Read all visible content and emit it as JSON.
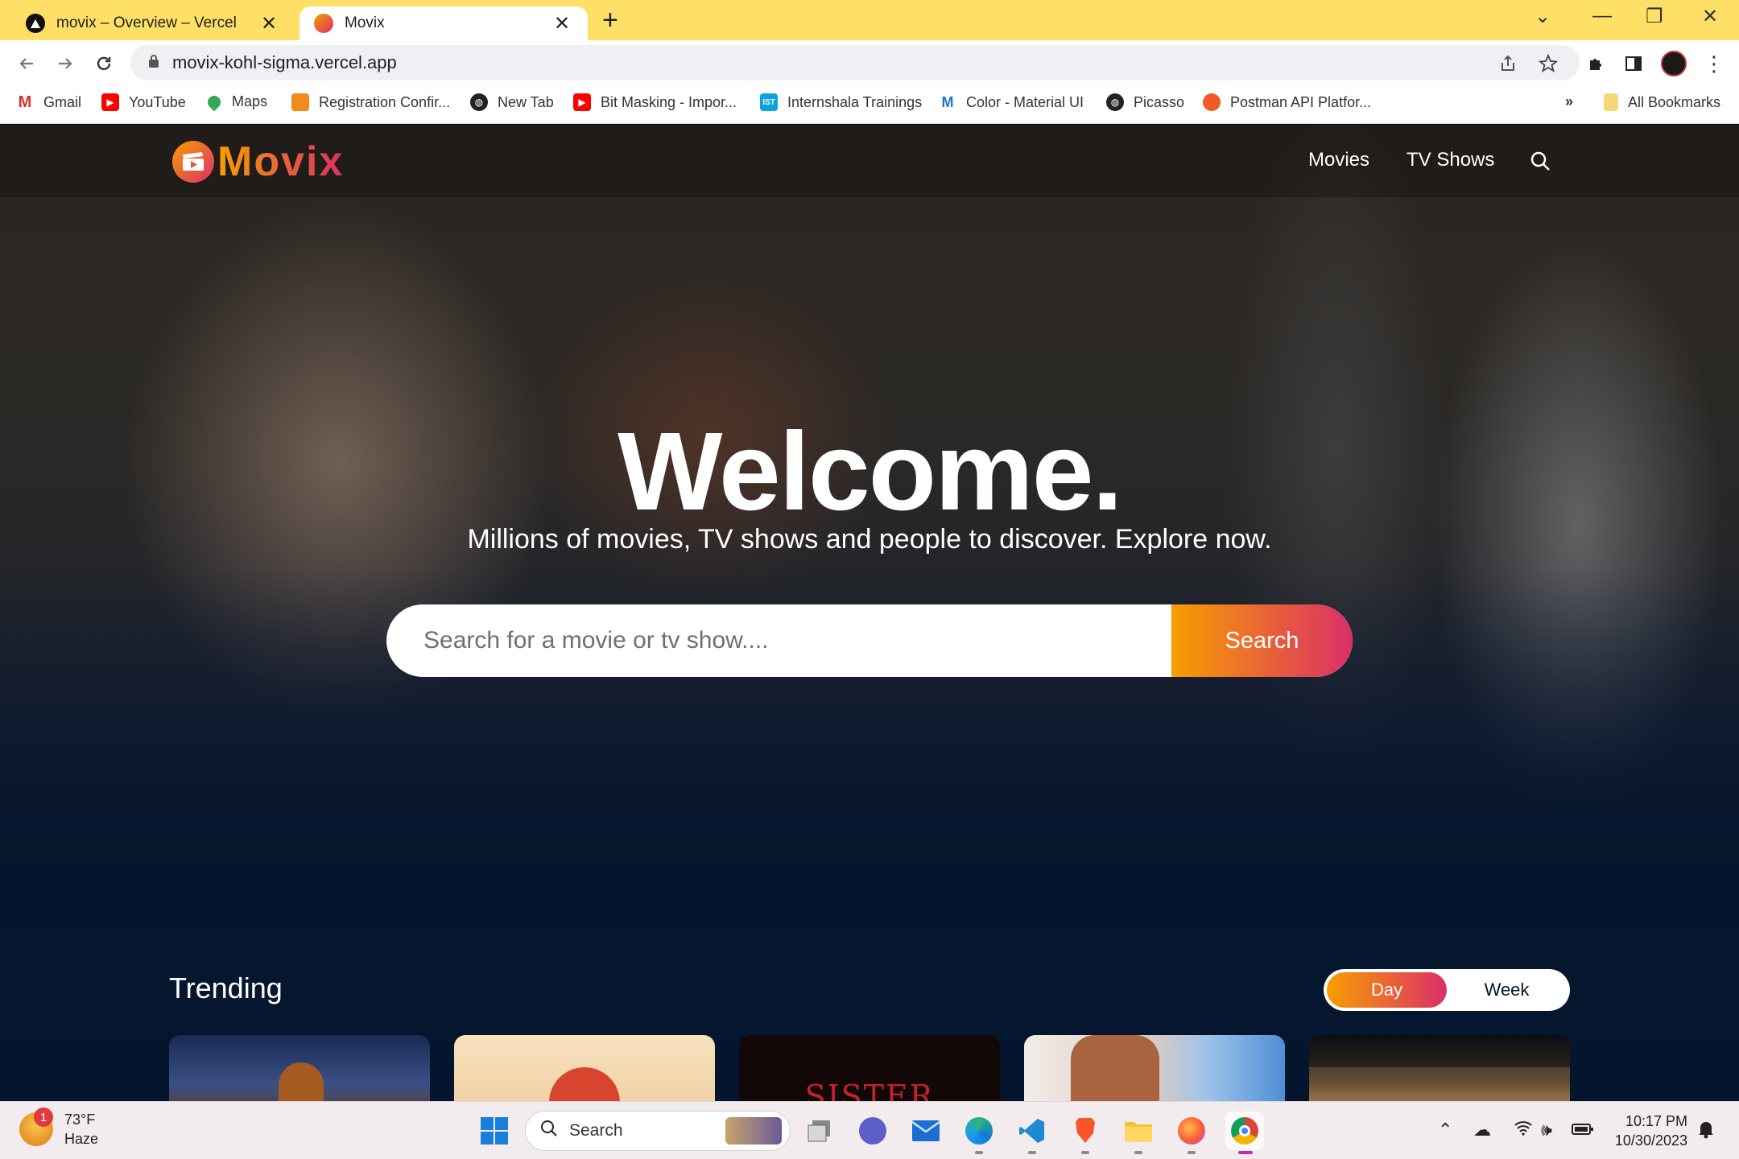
{
  "browser": {
    "tabs": [
      {
        "title": "movix – Overview – Vercel",
        "active": false
      },
      {
        "title": "Movix",
        "active": true
      }
    ],
    "url": "movix-kohl-sigma.vercel.app",
    "bookmarks": [
      {
        "label": "Gmail",
        "icon": "gmail-icon"
      },
      {
        "label": "YouTube",
        "icon": "youtube-icon"
      },
      {
        "label": "Maps",
        "icon": "maps-icon"
      },
      {
        "label": "Registration Confir...",
        "icon": "package-icon"
      },
      {
        "label": "New Tab",
        "icon": "globe-icon"
      },
      {
        "label": "Bit Masking - Impor...",
        "icon": "youtube-icon"
      },
      {
        "label": "Internshala Trainings",
        "icon": "ist-icon"
      },
      {
        "label": "Color - Material UI",
        "icon": "mui-icon"
      },
      {
        "label": "Picasso",
        "icon": "globe-icon"
      },
      {
        "label": "Postman API Platfor...",
        "icon": "postman-icon"
      }
    ],
    "bookmarks_overflow": "»",
    "all_bookmarks": "All Bookmarks"
  },
  "site": {
    "logo_text": "Movix",
    "nav": {
      "movies": "Movies",
      "tv_shows": "TV Shows"
    },
    "hero": {
      "title": "Welcome.",
      "subtitle": "Millions of movies, TV shows and people to discover. Explore now.",
      "search_placeholder": "Search for a movie or tv show....",
      "search_button": "Search"
    },
    "trending": {
      "title": "Trending",
      "options": [
        "Day",
        "Week"
      ],
      "selected": "Day"
    },
    "cards": [
      {
        "caption": ""
      },
      {
        "caption": ""
      },
      {
        "caption": "SISTER DEATH"
      },
      {
        "caption": ""
      },
      {
        "caption": ""
      }
    ]
  },
  "taskbar": {
    "weather": {
      "temp": "73°F",
      "condition": "Haze",
      "badge": "1"
    },
    "search_label": "Search",
    "time": "10:17 PM",
    "date": "10/30/2023"
  },
  "colors": {
    "tabstrip": "#fde065",
    "page_bg": "#04152d",
    "accent_start": "#f89e00",
    "accent_end": "#da2f68"
  }
}
